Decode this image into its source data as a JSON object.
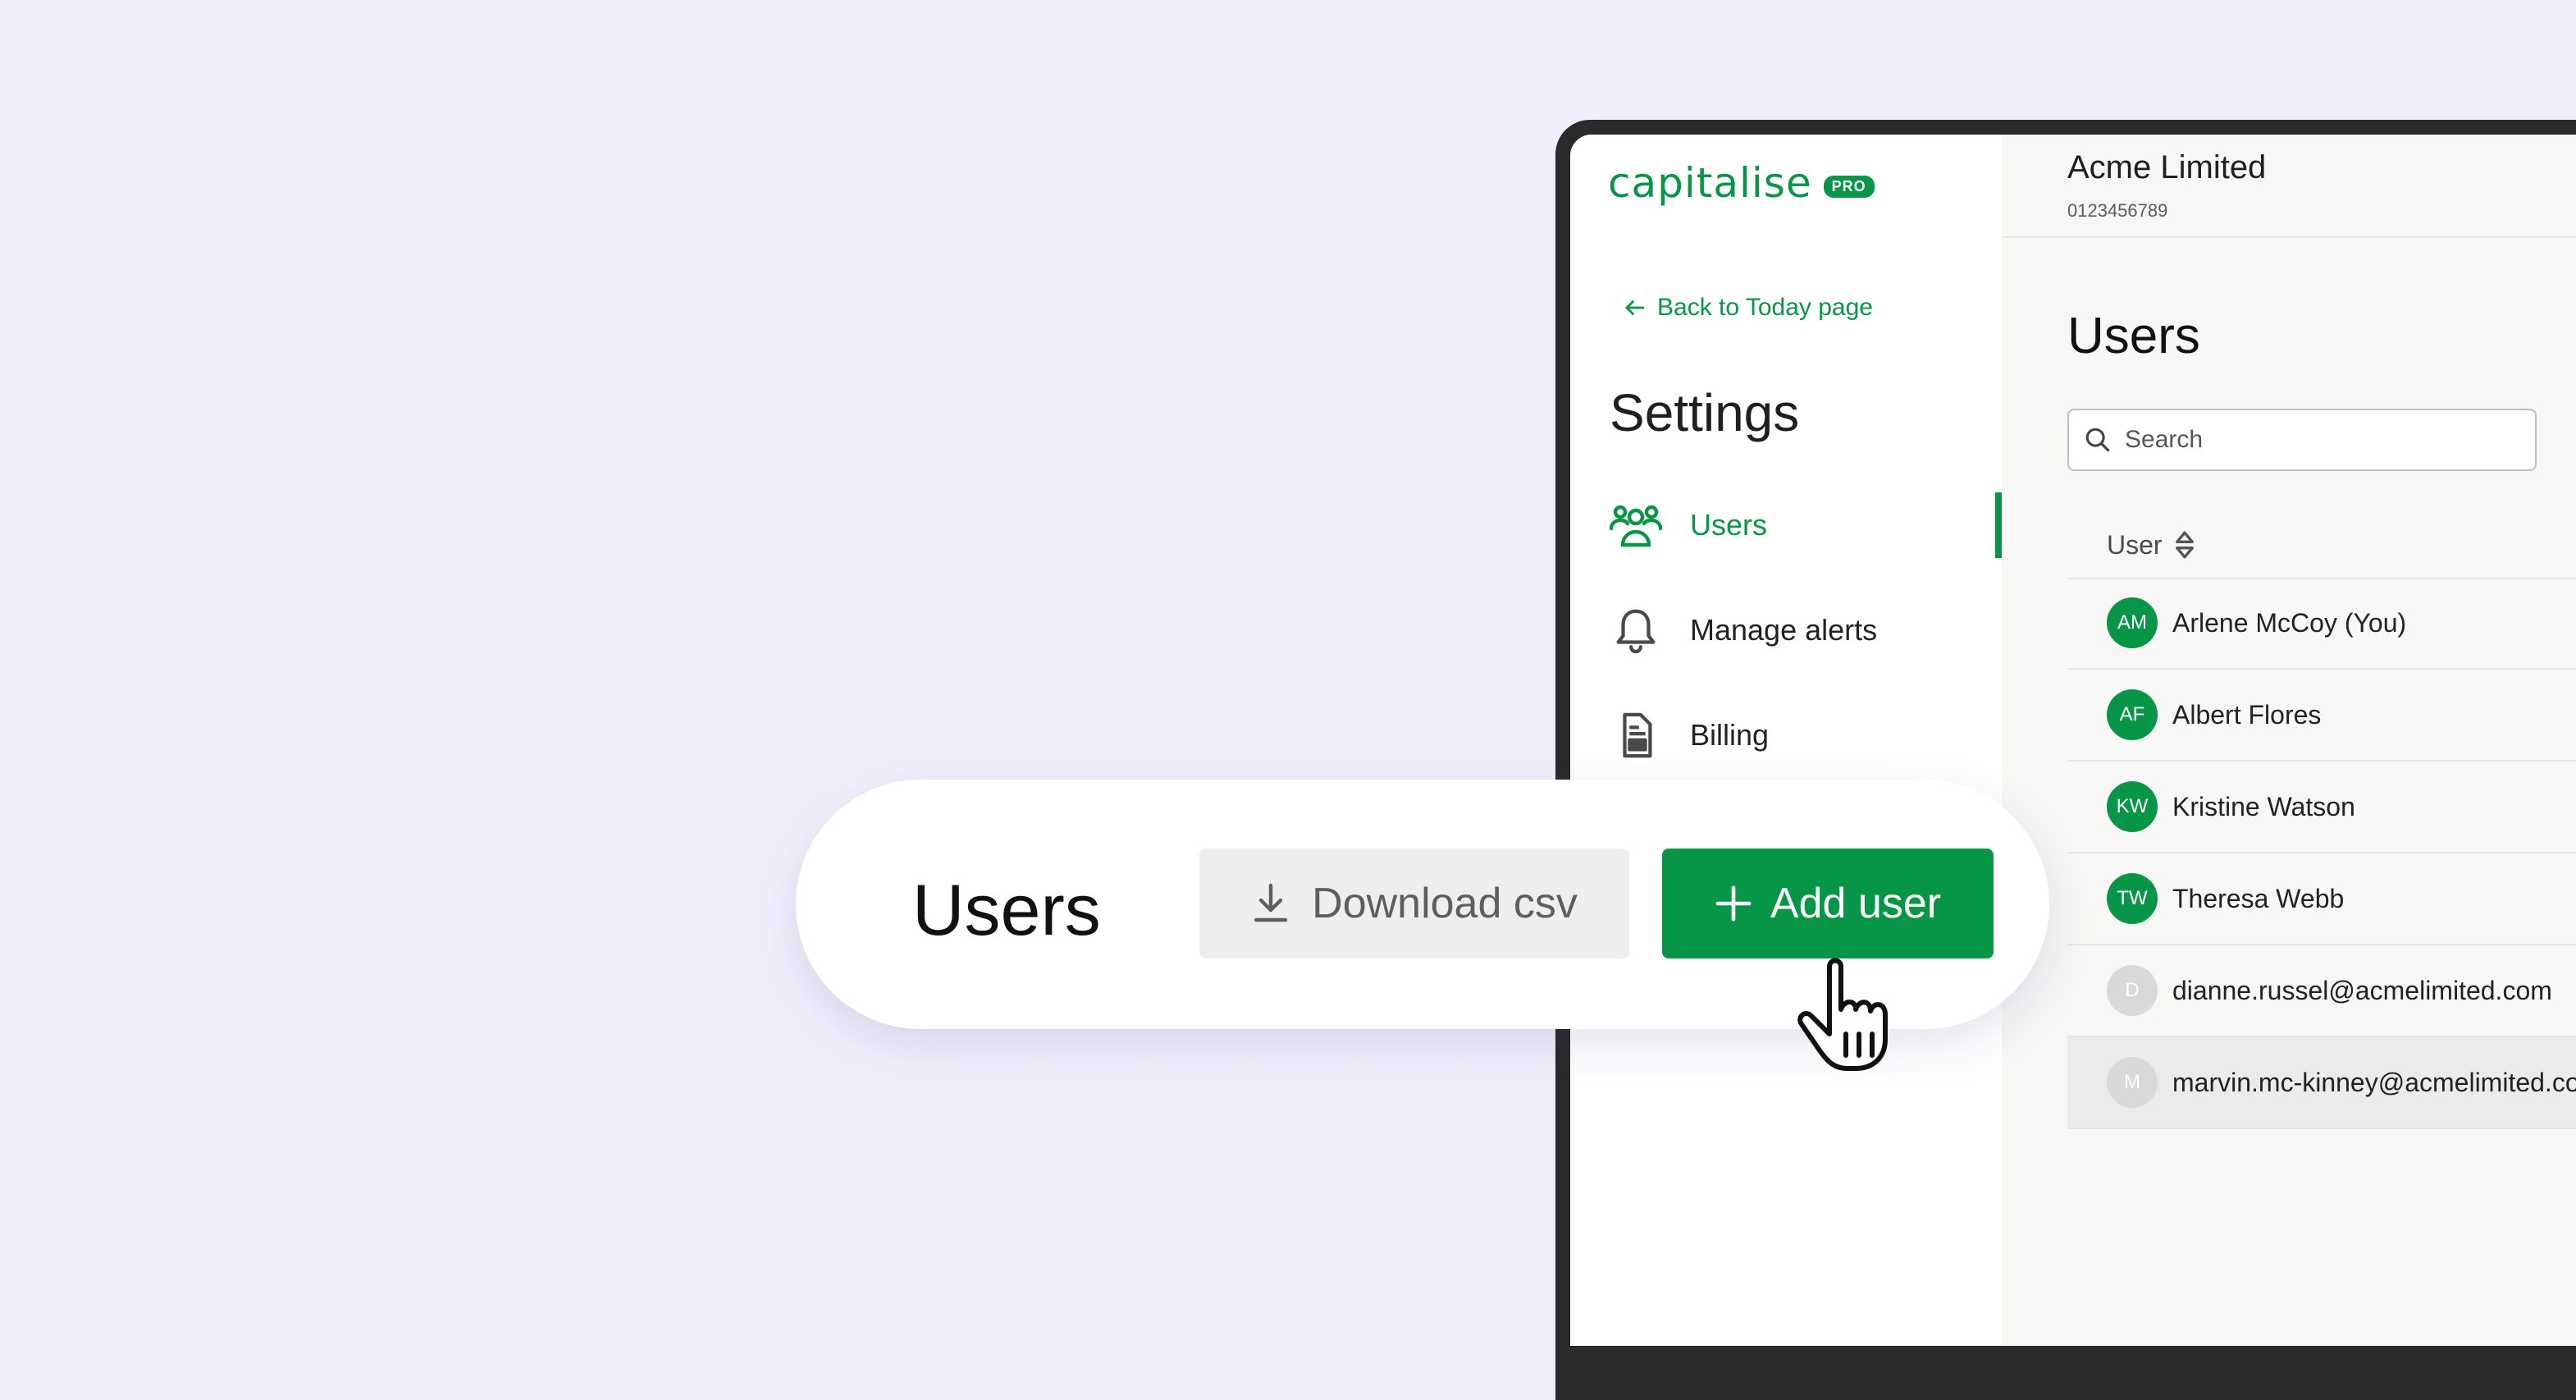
{
  "app": {
    "logo_text": "capitalise",
    "logo_badge": "PRO"
  },
  "sidebar": {
    "back_link": "Back to Today page",
    "title": "Settings",
    "items": [
      {
        "label": "Users",
        "icon": "users-icon",
        "active": true
      },
      {
        "label": "Manage alerts",
        "icon": "bell-icon",
        "active": false
      },
      {
        "label": "Billing",
        "icon": "document-icon",
        "active": false
      }
    ]
  },
  "header": {
    "company": "Acme Limited",
    "company_id": "0123456789"
  },
  "main": {
    "title": "Users",
    "search_placeholder": "Search",
    "table_header": "User",
    "rows": [
      {
        "initials": "AM",
        "name": "Arlene McCoy (You)",
        "status": "active"
      },
      {
        "initials": "AF",
        "name": "Albert Flores",
        "status": "active"
      },
      {
        "initials": "KW",
        "name": "Kristine Watson",
        "status": "active"
      },
      {
        "initials": "TW",
        "name": "Theresa Webb",
        "status": "active"
      },
      {
        "initials": "D",
        "name": "dianne.russel@acmelimited.com",
        "status": "pending"
      },
      {
        "initials": "M",
        "name": "marvin.mc-kinney@acmelimited.com",
        "status": "pending"
      }
    ]
  },
  "callout": {
    "title": "Users",
    "download_label": "Download csv",
    "add_label": "Add user"
  },
  "colors": {
    "brand_green": "#079547",
    "background": "#f1eefc",
    "pending_avatar": "#d9d9d9"
  }
}
